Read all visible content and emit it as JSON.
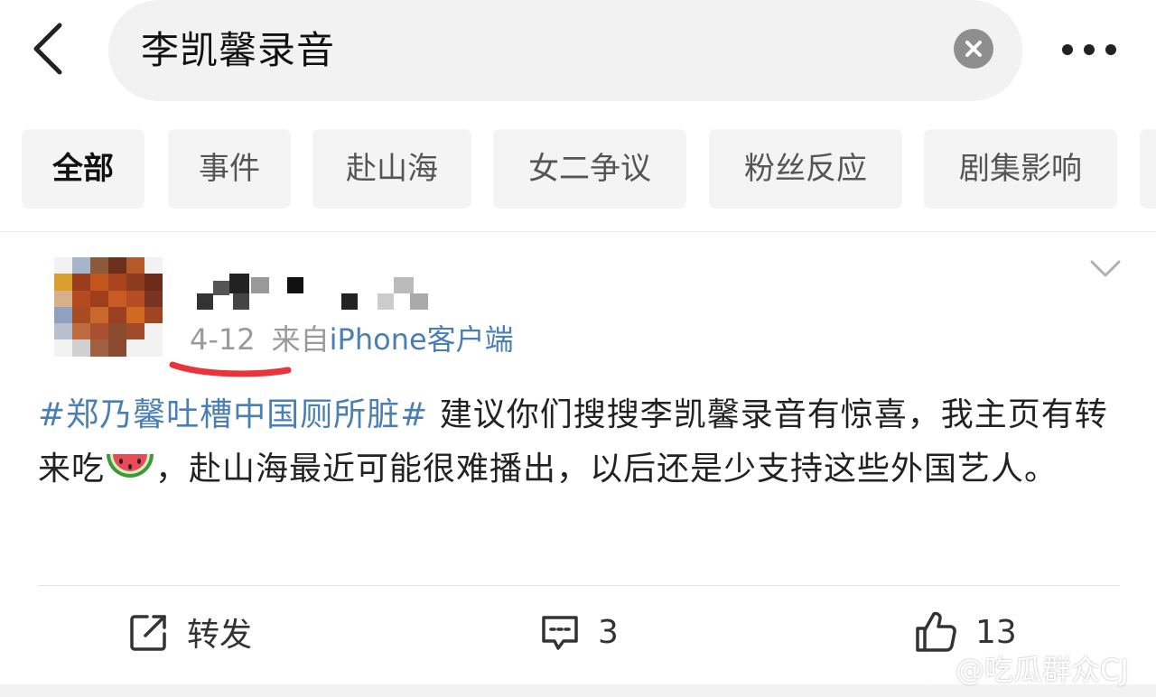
{
  "search": {
    "query": "李凯馨录音"
  },
  "tabs": [
    {
      "label": "全部",
      "active": true
    },
    {
      "label": "事件",
      "active": false
    },
    {
      "label": "赴山海",
      "active": false
    },
    {
      "label": "女二争议",
      "active": false
    },
    {
      "label": "粉丝反应",
      "active": false
    },
    {
      "label": "剧集影响",
      "active": false
    }
  ],
  "post": {
    "date": "4-12",
    "source_prefix": "来自",
    "source_client": "iPhone客户端",
    "hashtag": "#郑乃馨吐槽中国厕所脏#",
    "text_before_emoji": " 建议你们搜搜李凯馨录音有惊喜，我主页有转来吃",
    "emoji": "watermelon",
    "text_after_emoji": "，赴山海最近可能很难播出，以后还是少支持这些外国艺人。"
  },
  "actions": {
    "repost_label": "转发",
    "comment_count": "3",
    "like_count": "13"
  },
  "watermark": {
    "text": "@吃瓜群众CJ"
  },
  "colors": {
    "link_blue": "#4a7fb5",
    "underline_red": "#e8343a",
    "chip_bg": "#f4f4f4"
  }
}
